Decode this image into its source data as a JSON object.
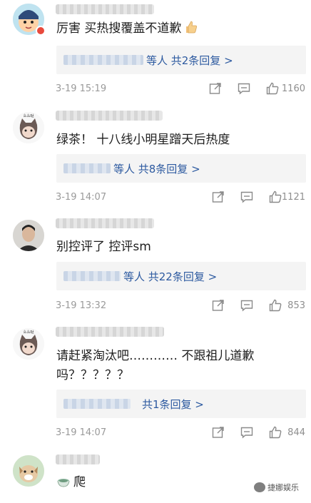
{
  "comments": [
    {
      "text": "厉害 买热搜覆盖不道歉",
      "reply_text": "等人 共2条回复 >",
      "time": "3-19 15:19",
      "likes": "1160"
    },
    {
      "text": "绿茶！ 十八线小明星蹭天后热度",
      "reply_text": "等人 共8条回复 >",
      "time": "3-19 14:07",
      "likes": "1121"
    },
    {
      "text": "别控评了 控评sm",
      "reply_text": "等人 共22条回复 >",
      "time": "3-19 13:32",
      "likes": "853"
    },
    {
      "text_line1": "请赶紧淘汰吧………… 不跟祖儿道歉",
      "text_line2": "吗？？？？？",
      "reply_text": "共1条回复 >",
      "time": "3-19 14:07",
      "likes": "844"
    },
    {
      "text": "爬"
    }
  ],
  "avatar_labels": [
    "么么哒",
    "么么哒"
  ],
  "watermark": "捷娜娱乐",
  "colors": {
    "reply_link": "#2d5aa0",
    "meta_gray": "#9a9a9a",
    "reply_bg": "#f4f4f4",
    "badge_red": "#e8493c"
  },
  "icons": [
    "share-icon",
    "comment-icon",
    "like-icon",
    "thumbs-up-emoji",
    "tea-emoji"
  ]
}
